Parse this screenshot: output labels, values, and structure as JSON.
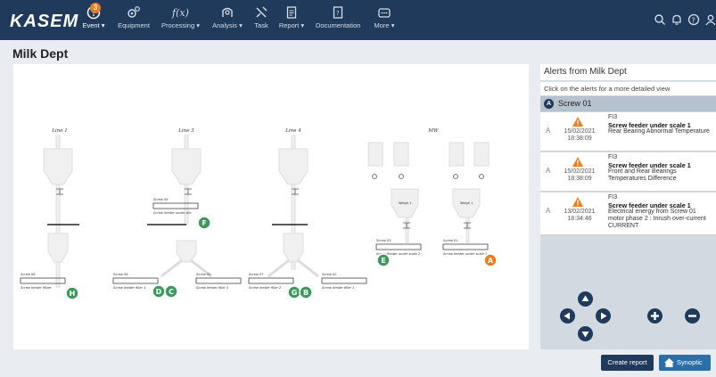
{
  "app": {
    "logo": "KASEM"
  },
  "nav": [
    {
      "label": "Event",
      "icon": "alert-circle-icon",
      "has_dropdown": true,
      "badge": "3"
    },
    {
      "label": "Equipment",
      "icon": "gears-icon",
      "has_dropdown": false
    },
    {
      "label": "Processing",
      "icon": "function-icon",
      "has_dropdown": true
    },
    {
      "label": "Analysis",
      "icon": "analysis-icon",
      "has_dropdown": true
    },
    {
      "label": "Task",
      "icon": "tools-icon",
      "has_dropdown": false
    },
    {
      "label": "Report",
      "icon": "report-icon",
      "has_dropdown": true
    },
    {
      "label": "Documentation",
      "icon": "documentation-icon",
      "has_dropdown": false
    },
    {
      "label": "More",
      "icon": "more-icon",
      "has_dropdown": true
    }
  ],
  "page": {
    "title": "Milk Dept"
  },
  "synoptic": {
    "lines": [
      "Line 1",
      "Line 3",
      "Line 4",
      "MW"
    ],
    "screws": [
      {
        "label": "Screw 08",
        "caption": "Screw feeder Mixer"
      },
      {
        "label": "Screw 06",
        "caption": "Screw feeder filler 4"
      },
      {
        "label": "Screw 05",
        "caption": "Screw feeder filler 3"
      },
      {
        "label": "Screw 09",
        "caption": "Screw feeder under silo"
      },
      {
        "label": "Screw 07",
        "caption": "Screw feeder filler 2"
      },
      {
        "label": "Screw 02",
        "caption": "Screw feeder filler 1"
      },
      {
        "label": "Screw 03",
        "caption": "Screw feeder under scale 2"
      },
      {
        "label": "Screw 01",
        "caption": "Screw feeder under scale 1"
      }
    ],
    "scales": [
      "Weigh 2",
      "Weigh 1"
    ],
    "markers": [
      {
        "letter": "H",
        "status": "ok"
      },
      {
        "letter": "D",
        "status": "ok"
      },
      {
        "letter": "C",
        "status": "ok"
      },
      {
        "letter": "F",
        "status": "ok"
      },
      {
        "letter": "G",
        "status": "ok"
      },
      {
        "letter": "B",
        "status": "ok"
      },
      {
        "letter": "E",
        "status": "ok"
      },
      {
        "letter": "A",
        "status": "alert"
      }
    ]
  },
  "alerts_panel": {
    "title": "Alerts from Milk Dept",
    "hint": "Click on the alerts for a more detailed view",
    "group": {
      "letter": "A",
      "label": "Screw 01"
    },
    "alerts": [
      {
        "level": "A",
        "date": "15/02/2021",
        "time": "18:38:09",
        "code": "FI3",
        "equipment": "Screw feeder under scale 1",
        "description": "Rear Bearing Abnormal Temperature"
      },
      {
        "level": "A",
        "date": "15/02/2021",
        "time": "18:38:09",
        "code": "FI3",
        "equipment": "Screw feeder under scale 1",
        "description": "Front and Rear Bearings Temperatures Difference"
      },
      {
        "level": "A",
        "date": "13/02/2021",
        "time": "18:34:46",
        "code": "FI3",
        "equipment": "Screw feeder under scale 1",
        "description": "Electrical energy from Screw 01 motor phase 2 : Inrush over-current CURRENT"
      }
    ]
  },
  "buttons": {
    "create_report": "Create report",
    "synoptic": "Synoptic"
  },
  "colors": {
    "topbar": "#1f3a5a",
    "ok_marker": "#3a9a5b",
    "alert_marker": "#f07d1d",
    "warning": "#f07d1d",
    "badge": "#f07d1d"
  }
}
